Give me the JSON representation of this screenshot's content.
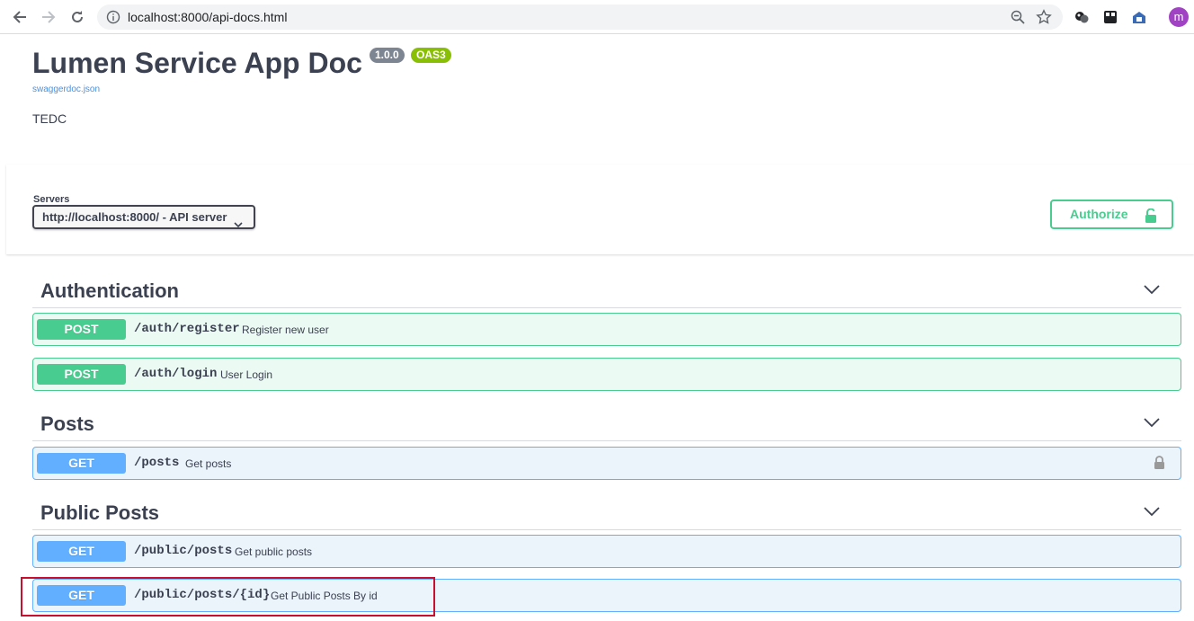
{
  "browser": {
    "url": "localhost:8000/api-docs.html",
    "profile_initial": "m"
  },
  "info": {
    "title": "Lumen Service App Doc",
    "version": "1.0.0",
    "oas": "OAS3",
    "spec_link": "swaggerdoc.json",
    "description": "TEDC"
  },
  "servers": {
    "label": "Servers",
    "selected": "http://localhost:8000/ - API server"
  },
  "authorize": {
    "label": "Authorize"
  },
  "tags": [
    {
      "name": "Authentication",
      "operations": [
        {
          "method": "POST",
          "path": "/auth/register",
          "summary": "Register new user"
        },
        {
          "method": "POST",
          "path": "/auth/login",
          "summary": "User Login"
        }
      ]
    },
    {
      "name": "Posts",
      "operations": [
        {
          "method": "GET",
          "path": "/posts",
          "summary": "Get posts"
        }
      ]
    },
    {
      "name": "Public Posts",
      "operations": [
        {
          "method": "GET",
          "path": "/public/posts",
          "summary": "Get public posts"
        },
        {
          "method": "GET",
          "path": "/public/posts/{id}",
          "summary": "Get Public Posts By id"
        }
      ]
    }
  ],
  "colors": {
    "post": "#49cc90",
    "get": "#61affe",
    "highlight": "#c8102e"
  }
}
